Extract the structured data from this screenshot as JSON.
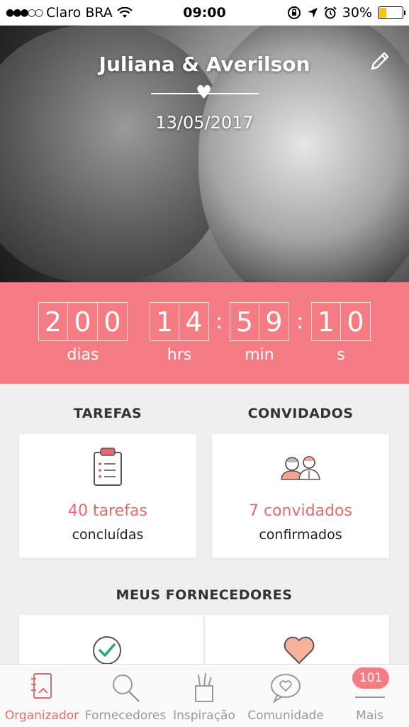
{
  "status_bar": {
    "carrier": "Claro BRA",
    "time": "09:00",
    "battery": "30%",
    "battery_level": 0.3
  },
  "hero": {
    "couple_names": "Juliana & Averilson",
    "wedding_date": "13/05/2017"
  },
  "countdown": {
    "days": [
      "2",
      "0",
      "0"
    ],
    "hours": [
      "1",
      "4"
    ],
    "minutes": [
      "5",
      "9"
    ],
    "seconds": [
      "1",
      "0"
    ],
    "labels": {
      "days": "dias",
      "hours": "hrs",
      "minutes": "min",
      "seconds": "s"
    }
  },
  "tasks": {
    "title": "TAREFAS",
    "count_label": "40 tarefas",
    "status_label": "concluídas"
  },
  "guests": {
    "title": "CONVIDADOS",
    "count_label": "7 convidados",
    "status_label": "confirmados"
  },
  "vendors": {
    "title": "MEUS FORNECEDORES"
  },
  "tabbar": {
    "items": [
      {
        "label": "Organizador",
        "icon": "notebook-icon"
      },
      {
        "label": "Fornecedores",
        "icon": "search-icon"
      },
      {
        "label": "Inspiração",
        "icon": "tools-icon"
      },
      {
        "label": "Comunidade",
        "icon": "chat-heart-icon"
      },
      {
        "label": "Mais",
        "icon": "menu-icon"
      }
    ],
    "badge": "101"
  },
  "colors": {
    "accent": "#f57c82",
    "accent_text": "#e56a6f",
    "green_check": "#2aaa6a"
  }
}
